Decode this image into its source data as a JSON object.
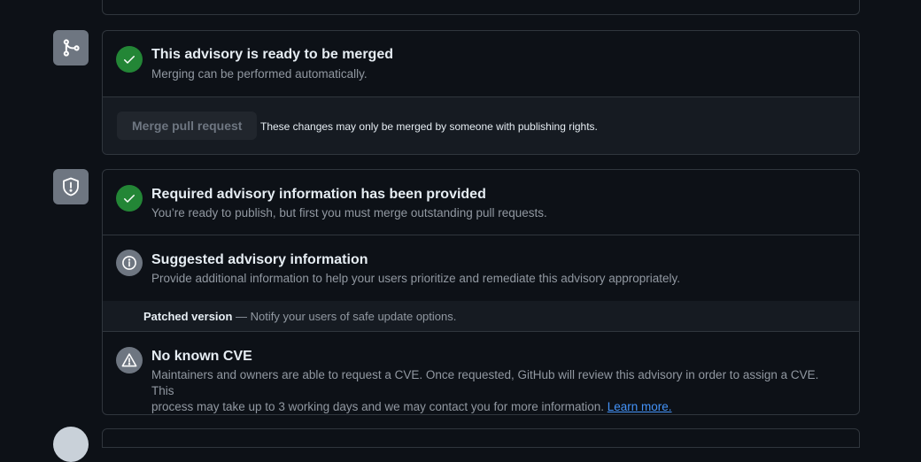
{
  "merge_card": {
    "title": "This advisory is ready to be merged",
    "subtitle": "Merging can be performed automatically.",
    "button_label": "Merge pull request",
    "note": "These changes may only be merged by someone with publishing rights."
  },
  "advisory_card": {
    "required": {
      "title": "Required advisory information has been provided",
      "subtitle": "You’re ready to publish, but first you must merge outstanding pull requests."
    },
    "suggested": {
      "title": "Suggested advisory information",
      "subtitle": "Provide additional information to help your users prioritize and remediate this advisory appropriately.",
      "patched_label": "Patched version",
      "patched_rest": " — Notify your users of safe update options."
    },
    "cve": {
      "title": "No known CVE",
      "line1": "Maintainers and owners are able to request a CVE. Once requested, GitHub will review this advisory in order to assign a CVE. This",
      "line2": "process may take up to 3 working days and we may contact you for more information. ",
      "link": "Learn more."
    }
  },
  "icons": {
    "merge_side": "git-merge-icon",
    "shield_side": "shield-alert-icon",
    "check": "check-icon",
    "info": "info-icon",
    "alert": "alert-triangle-icon"
  },
  "colors": {
    "success": "#238636",
    "neutral": "#6e7681",
    "link": "#4493f8",
    "background": "#0d1117"
  }
}
